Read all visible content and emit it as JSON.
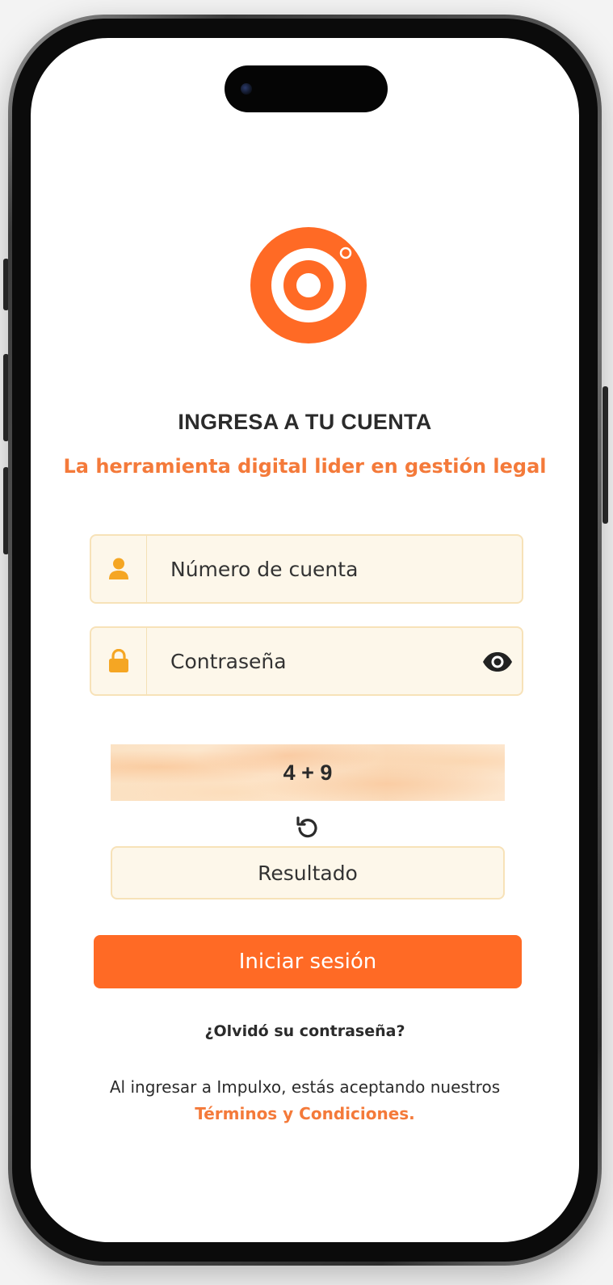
{
  "header": {
    "title": "INGRESA A TU CUENTA",
    "subtitle": "La herramienta digital lider en gestión legal"
  },
  "form": {
    "account_placeholder": "Número de cuenta",
    "password_placeholder": "Contraseña",
    "captcha_text": "4 + 9",
    "result_placeholder": "Resultado",
    "submit_label": "Iniciar sesión",
    "forgot_label": "¿Olvidó su contraseña?"
  },
  "legal": {
    "text": "Al ingresar a Impulxo, estás aceptando nuestros",
    "link_label": "Términos y Condiciones."
  },
  "icons": {
    "logo": "target-logo",
    "account": "user-icon",
    "password": "lock-icon",
    "show_password": "eye-icon",
    "refresh": "refresh-icon"
  },
  "colors": {
    "brand": "#ff6a25",
    "accent_text": "#f47a3a",
    "icon": "#f5a623",
    "field_bg": "#fdf7ea",
    "field_border": "#f7e2b8"
  }
}
